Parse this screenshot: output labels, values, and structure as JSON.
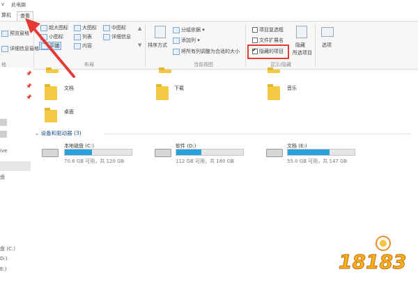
{
  "titlebar": {
    "left": "v",
    "title": "此电脑"
  },
  "tabs": [
    {
      "label": "算机"
    },
    {
      "label": "查看"
    }
  ],
  "ribbon": {
    "pane": {
      "preview_pane": "预览窗格",
      "details_pane": "详细信息窗格",
      "group": "格"
    },
    "layout": {
      "items": [
        "超大图标",
        "大图标",
        "中图标",
        "小图标",
        "列表",
        "详细信息",
        "平铺",
        "内容"
      ],
      "group": "布局"
    },
    "current_view": {
      "sort_by": "排序方式",
      "group_by": "分组依据",
      "add_columns": "添加列",
      "fit_columns": "将所有列调整为合适的大小",
      "group": "当前视图"
    },
    "show_hide": {
      "item_checkboxes": "项目复选框",
      "file_extensions": "文件扩展名",
      "hidden_items": "隐藏的项目",
      "hide_selected": "隐藏",
      "hide_selected_2": "所选项目",
      "options": "选项",
      "group": "显示/隐藏"
    }
  },
  "nav": {
    "items": [
      "ive",
      "盘",
      "盘 (C:)",
      "D:)",
      "E:)"
    ]
  },
  "folders": [
    {
      "name": "文档"
    },
    {
      "name": "下载"
    },
    {
      "name": "音乐"
    },
    {
      "name": "桌面"
    }
  ],
  "devices": {
    "header": "设备和驱动器 (3)",
    "drives": [
      {
        "name": "本地磁盘 (C:)",
        "size": "70.6 GB 可用，共 120 GB",
        "used_fraction": 0.41
      },
      {
        "name": "软件 (D:)",
        "size": "112 GB 可用，共 180 GB",
        "used_fraction": 0.38
      },
      {
        "name": "文档 (E:)",
        "size": "55.0 GB 可用，共 147 GB",
        "used_fraction": 0.63
      }
    ]
  },
  "watermark": {
    "text": "18183"
  },
  "colors": {
    "accent": "#26a0da",
    "highlight": "#e53935",
    "folder": "#f3c843"
  }
}
